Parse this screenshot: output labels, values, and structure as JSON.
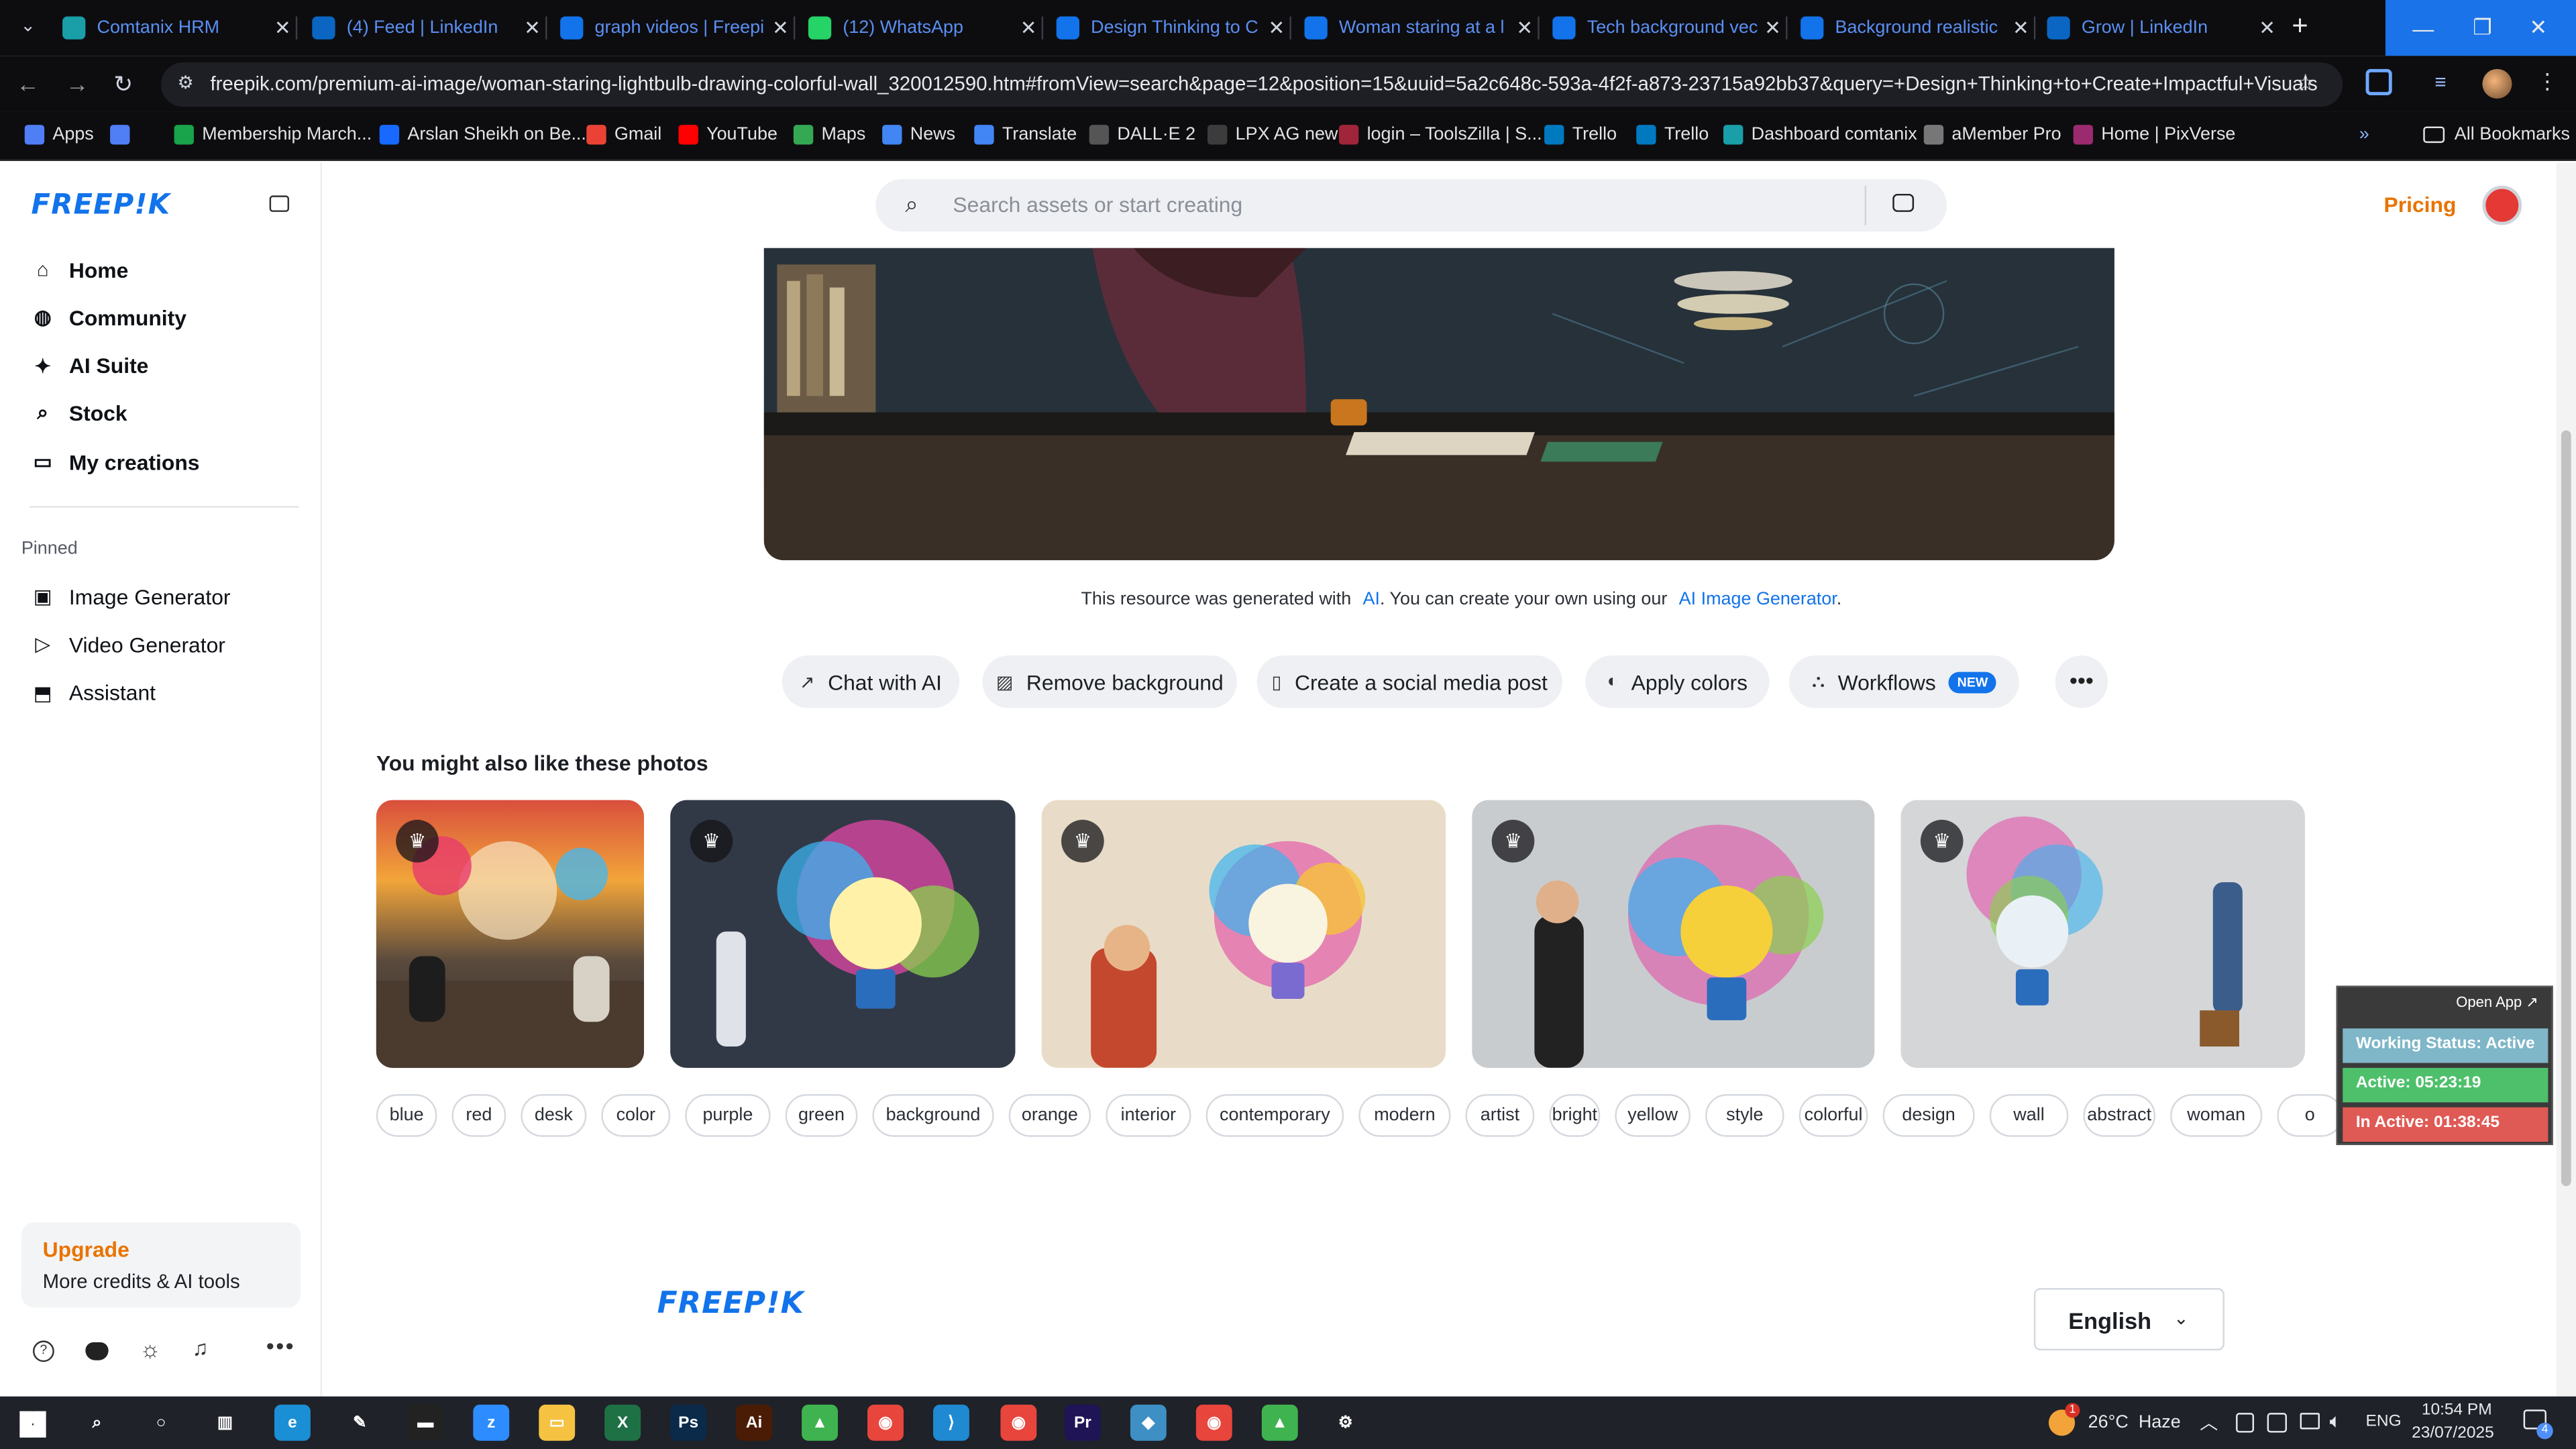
{
  "browser": {
    "tabs": [
      {
        "title": "Comtanix HRM",
        "icon": "comtanix-icon",
        "color": "#1a9ea8"
      },
      {
        "title": "(4) Feed | LinkedIn",
        "icon": "linkedin-icon",
        "color": "#0a66c2"
      },
      {
        "title": "graph videos | Freepi",
        "icon": "freepik-icon",
        "color": "#1273eb"
      },
      {
        "title": "(12) WhatsApp",
        "icon": "whatsapp-icon",
        "color": "#25d366"
      },
      {
        "title": "Design Thinking to C",
        "icon": "freepik-icon",
        "color": "#1273eb"
      },
      {
        "title": "Woman staring at a l",
        "icon": "freepik-icon",
        "color": "#1273eb"
      },
      {
        "title": "Tech background vec",
        "icon": "freepik-icon",
        "color": "#1273eb"
      },
      {
        "title": "Background realistic",
        "icon": "freepik-icon",
        "color": "#1273eb"
      },
      {
        "title": "Grow | LinkedIn",
        "icon": "linkedin-icon",
        "color": "#0a66c2"
      }
    ],
    "url": "freepik.com/premium-ai-image/woman-staring-lightbulb-drawing-colorful-wall_320012590.htm#fromView=search&page=12&position=15&uuid=5a2c648c-593a-4f2f-a873-23715a92bb37&query=+Design+Thinking+to+Create+Impactful+Visuals",
    "bookmarks": [
      {
        "label": "Apps",
        "icon": "apps-grid-icon",
        "color": "#4f7ef5"
      },
      {
        "label": "",
        "icon": "grid-icon",
        "color": "#4f7ef5"
      },
      {
        "label": "Membership March...",
        "icon": "membership-icon",
        "color": "#19a34a"
      },
      {
        "label": "Arslan Sheikh on Be...",
        "icon": "behance-icon",
        "color": "#1769ff"
      },
      {
        "label": "Gmail",
        "icon": "gmail-icon",
        "color": "#ea4335"
      },
      {
        "label": "YouTube",
        "icon": "youtube-icon",
        "color": "#ff0000"
      },
      {
        "label": "Maps",
        "icon": "maps-icon",
        "color": "#34a853"
      },
      {
        "label": "News",
        "icon": "news-icon",
        "color": "#4285f4"
      },
      {
        "label": "Translate",
        "icon": "translate-icon",
        "color": "#4285f4"
      },
      {
        "label": "DALL·E 2",
        "icon": "openai-icon",
        "color": "#555555"
      },
      {
        "label": "LPX AG new",
        "icon": "link-icon",
        "color": "#3c3c3c"
      },
      {
        "label": "login – ToolsZilla | S...",
        "icon": "toolszilla-icon",
        "color": "#a0253a"
      },
      {
        "label": "Trello",
        "icon": "trello-icon",
        "color": "#0079bf"
      },
      {
        "label": "Trello",
        "icon": "trello-icon",
        "color": "#0079bf"
      },
      {
        "label": "Dashboard comtanix",
        "icon": "comtanix-icon",
        "color": "#1a9ea8"
      },
      {
        "label": "aMember Pro",
        "icon": "amember-icon",
        "color": "#777777"
      },
      {
        "label": "Home | PixVerse",
        "icon": "pixverse-icon",
        "color": "#9b2a6f"
      }
    ],
    "all_bookmarks": "All Bookmarks"
  },
  "sidebar": {
    "logo": "FREEP!K",
    "nav": [
      {
        "label": "Home",
        "icon": "home-icon",
        "glyph": "⌂"
      },
      {
        "label": "Community",
        "icon": "globe-icon",
        "glyph": "◍"
      },
      {
        "label": "AI Suite",
        "icon": "sparkle-icon",
        "glyph": "✦"
      },
      {
        "label": "Stock",
        "icon": "search-icon",
        "glyph": "⌕"
      },
      {
        "label": "My creations",
        "icon": "folder-icon",
        "glyph": "▭"
      }
    ],
    "pinned_heading": "Pinned",
    "pinned": [
      {
        "label": "Image Generator",
        "icon": "image-icon",
        "glyph": "▣"
      },
      {
        "label": "Video Generator",
        "icon": "video-icon",
        "glyph": "▷"
      },
      {
        "label": "Assistant",
        "icon": "assistant-icon",
        "glyph": "⬒"
      }
    ],
    "upgrade_title": "Upgrade",
    "upgrade_sub": "More credits & AI tools"
  },
  "header": {
    "search_placeholder": "Search assets or start creating",
    "pricing": "Pricing"
  },
  "main": {
    "ai_note_prefix": "This resource was generated with",
    "ai_note_ai": "AI",
    "ai_note_middle": ". You can create your own using our",
    "ai_note_link": "AI Image Generator",
    "ai_note_end": ".",
    "actions": [
      {
        "label": "Chat with AI",
        "icon": "chat-icon",
        "glyph": "↗"
      },
      {
        "label": "Remove background",
        "icon": "remove-bg-icon",
        "glyph": "▨"
      },
      {
        "label": "Create a social media post",
        "icon": "phone-icon",
        "glyph": "▯"
      },
      {
        "label": "Apply colors",
        "icon": "palette-icon",
        "glyph": "◐"
      },
      {
        "label": "Workflows",
        "icon": "workflow-icon",
        "glyph": "⛬",
        "badge": "NEW"
      }
    ],
    "related_heading": "You might also like these photos",
    "tags": [
      "blue",
      "red",
      "desk",
      "color",
      "purple",
      "green",
      "background",
      "orange",
      "interior",
      "contemporary",
      "modern",
      "artist",
      "bright",
      "yellow",
      "style",
      "colorful",
      "design",
      "wall",
      "abstract",
      "woman",
      "o"
    ]
  },
  "footer": {
    "logo": "FREEP!K",
    "language": "English"
  },
  "widget": {
    "open_app": "Open App ↗",
    "status": "Working Status: Active",
    "active": "Active: 05:23:19",
    "inactive": "In Active: 01:38:45"
  },
  "taskbar": {
    "weather": "26°C  Haze",
    "weather_badge": "1",
    "lang": "ENG",
    "time": "10:54 PM",
    "date": "23/07/2025",
    "notif_count": "4"
  }
}
